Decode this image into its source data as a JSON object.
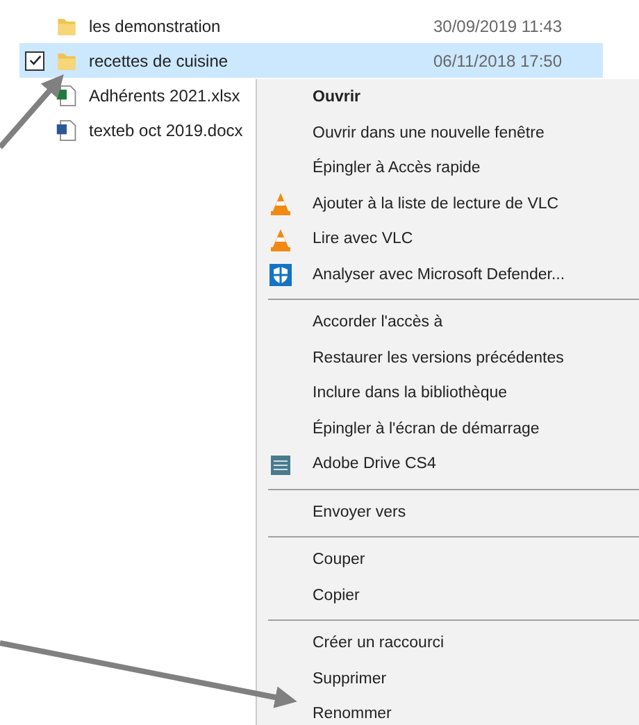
{
  "files": [
    {
      "name": "les demonstration",
      "date": "30/09/2019 11:43",
      "kind": "folder",
      "selected": false
    },
    {
      "name": "recettes de cuisine",
      "date": "06/11/2018 17:50",
      "kind": "folder",
      "selected": true
    },
    {
      "name": "Adhérents 2021.xlsx",
      "kind": "sheet",
      "selected": false
    },
    {
      "name": "texteb oct 2019.docx",
      "kind": "doc",
      "selected": false
    }
  ],
  "context_menu": {
    "items": [
      {
        "kind": "text",
        "label": "Ouvrir",
        "default": true
      },
      {
        "kind": "text",
        "label": "Ouvrir dans une nouvelle fenêtre",
        "default": false
      },
      {
        "kind": "text",
        "label": "Épingler à Accès rapide",
        "default": false
      },
      {
        "kind": "cone",
        "label": "Ajouter à la liste de lecture de VLC",
        "default": false
      },
      {
        "kind": "cone",
        "label": "Lire avec VLC",
        "default": false
      },
      {
        "kind": "shield",
        "label": "Analyser avec Microsoft Defender...",
        "default": false
      },
      {
        "kind": "separator"
      },
      {
        "kind": "text",
        "label": "Accorder l'accès à",
        "default": false
      },
      {
        "kind": "text",
        "label": "Restaurer les versions précédentes",
        "default": false
      },
      {
        "kind": "text",
        "label": "Inclure dans la bibliothèque",
        "default": false
      },
      {
        "kind": "text",
        "label": "Épingler à l'écran de démarrage",
        "default": false
      },
      {
        "kind": "drive",
        "label": "Adobe Drive CS4",
        "default": false
      },
      {
        "kind": "separator"
      },
      {
        "kind": "text",
        "label": "Envoyer vers",
        "default": false
      },
      {
        "kind": "separator"
      },
      {
        "kind": "text",
        "label": "Couper",
        "default": false
      },
      {
        "kind": "text",
        "label": "Copier",
        "default": false
      },
      {
        "kind": "separator"
      },
      {
        "kind": "text",
        "label": "Créer un raccourci",
        "default": false
      },
      {
        "kind": "text",
        "label": "Supprimer",
        "default": false
      },
      {
        "kind": "text",
        "label": "Renommer",
        "default": false
      }
    ]
  }
}
